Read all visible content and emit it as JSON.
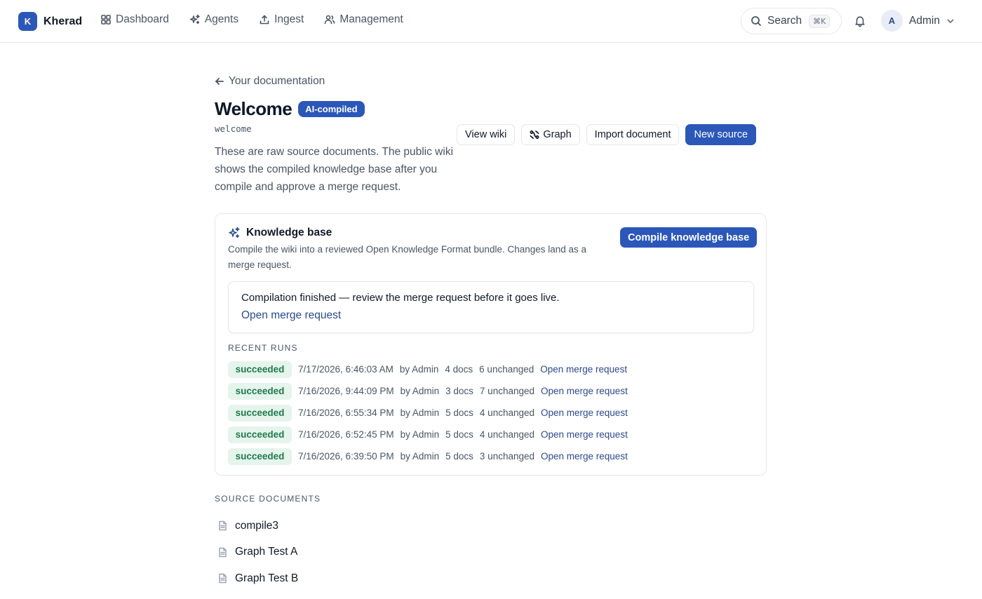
{
  "brand": {
    "initial": "K",
    "name": "Kherad"
  },
  "nav": {
    "items": [
      {
        "label": "Dashboard",
        "icon": "grid-icon"
      },
      {
        "label": "Agents",
        "icon": "sparkles-icon"
      },
      {
        "label": "Ingest",
        "icon": "upload-icon"
      },
      {
        "label": "Management",
        "icon": "users-icon"
      }
    ],
    "search_label": "Search",
    "search_shortcut": "⌘K",
    "user_initial": "A",
    "user_name": "Admin"
  },
  "header": {
    "back_label": "Your documentation",
    "title": "Welcome",
    "badge": "AI-compiled",
    "slug": "welcome",
    "description": "These are raw source documents. The public wiki shows the compiled knowledge base after you compile and approve a merge request."
  },
  "actions": {
    "view_wiki": "View wiki",
    "graph": "Graph",
    "import_document": "Import document",
    "new_source": "New source"
  },
  "knowledge_base": {
    "title": "Knowledge base",
    "description": "Compile the wiki into a reviewed Open Knowledge Format bundle. Changes land as a merge request.",
    "compile_button": "Compile knowledge base",
    "notice_text": "Compilation finished — review the merge request before it goes live.",
    "notice_link": "Open merge request",
    "recent_runs_heading": "Recent runs",
    "runs": [
      {
        "status": "succeeded",
        "time": "7/17/2026, 6:46:03 AM",
        "by": "by Admin",
        "docs": "4 docs",
        "unchanged": "6 unchanged",
        "link": "Open merge request"
      },
      {
        "status": "succeeded",
        "time": "7/16/2026, 9:44:09 PM",
        "by": "by Admin",
        "docs": "3 docs",
        "unchanged": "7 unchanged",
        "link": "Open merge request"
      },
      {
        "status": "succeeded",
        "time": "7/16/2026, 6:55:34 PM",
        "by": "by Admin",
        "docs": "5 docs",
        "unchanged": "4 unchanged",
        "link": "Open merge request"
      },
      {
        "status": "succeeded",
        "time": "7/16/2026, 6:52:45 PM",
        "by": "by Admin",
        "docs": "5 docs",
        "unchanged": "4 unchanged",
        "link": "Open merge request"
      },
      {
        "status": "succeeded",
        "time": "7/16/2026, 6:39:50 PM",
        "by": "by Admin",
        "docs": "5 docs",
        "unchanged": "3 unchanged",
        "link": "Open merge request"
      }
    ]
  },
  "source_documents": {
    "heading": "Source documents",
    "items": [
      {
        "label": "compile3"
      },
      {
        "label": "Graph Test A"
      },
      {
        "label": "Graph Test B"
      }
    ]
  },
  "colors": {
    "accent": "#2b57b8",
    "link": "#2b4a8f",
    "success_bg": "#e5f4ec",
    "success_text": "#1f7a4c"
  }
}
